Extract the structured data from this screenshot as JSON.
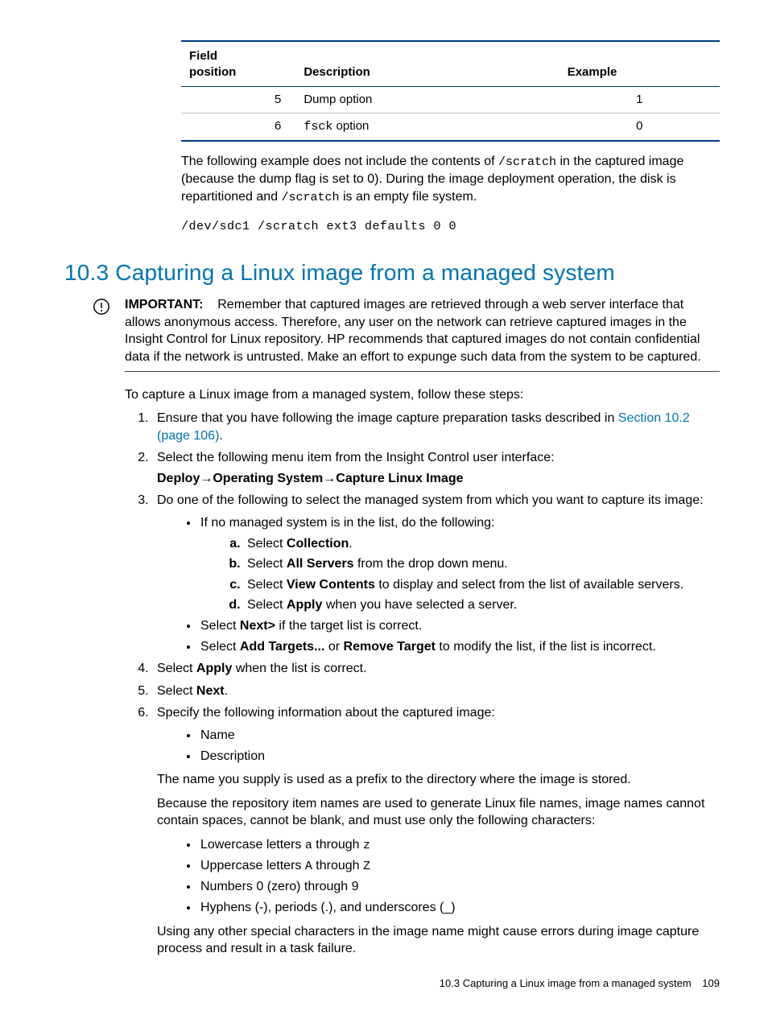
{
  "table": {
    "headers": {
      "c1a": "Field",
      "c1b": "position",
      "c2": "Description",
      "c3": "Example"
    },
    "rows": [
      {
        "pos": "5",
        "desc_pre": "Dump option",
        "desc_mono": "",
        "ex": "1"
      },
      {
        "pos": "6",
        "desc_pre": "",
        "desc_mono": "fsck",
        "desc_post": " option",
        "ex": "0"
      }
    ]
  },
  "para1_a": "The following example does not include the contents of ",
  "para1_mono1": "/scratch",
  "para1_b": " in the captured image (because the dump flag is set to 0). During the image deployment operation, the disk is repartitioned and ",
  "para1_mono2": "/scratch",
  "para1_c": " is an empty file system.",
  "codeline": "/dev/sdc1 /scratch ext3 defaults 0 0",
  "section_title": "10.3 Capturing a Linux image from a managed system",
  "important": {
    "label": "IMPORTANT:",
    "text": "Remember that captured images are retrieved through a web server interface that allows anonymous access. Therefore, any user on the network can retrieve captured images in the Insight Control for Linux repository. HP recommends that captured images do not contain confidential data if the network is untrusted. Make an effort to expunge such data from the system to be captured."
  },
  "intro": "To capture a Linux image from a managed system, follow these steps:",
  "step1_a": "Ensure that you have following the image capture preparation tasks described in ",
  "step1_link": "Section 10.2 (page 106)",
  "step1_b": ".",
  "step2": "Select the following menu item from the Insight Control user interface:",
  "menu_path": "Deploy→Operating System→Capture Linux Image",
  "step3": "Do one of the following to select the managed system from which you want to capture its image:",
  "s3_b1": "If no managed system is in the list, do the following:",
  "s3_b1_a_pre": "Select ",
  "s3_b1_a_bold": "Collection",
  "s3_b1_a_post": ".",
  "s3_b1_b_pre": "Select ",
  "s3_b1_b_bold": "All Servers",
  "s3_b1_b_post": " from the drop down menu.",
  "s3_b1_c_pre": "Select ",
  "s3_b1_c_bold": "View Contents",
  "s3_b1_c_post": " to display and select from the list of available servers.",
  "s3_b1_d_pre": "Select ",
  "s3_b1_d_bold": "Apply",
  "s3_b1_d_post": " when you have selected a server.",
  "s3_b2_pre": "Select ",
  "s3_b2_bold": "Next>",
  "s3_b2_post": " if the target list is correct.",
  "s3_b3_pre": "Select ",
  "s3_b3_bold1": "Add Targets...",
  "s3_b3_mid": " or ",
  "s3_b3_bold2": "Remove Target",
  "s3_b3_post": " to modify the list, if the list is incorrect.",
  "step4_pre": "Select ",
  "step4_bold": "Apply",
  "step4_post": " when the list is correct.",
  "step5_pre": "Select ",
  "step5_bold": "Next",
  "step5_post": ".",
  "step6": "Specify the following information about the captured image:",
  "s6_b1": "Name",
  "s6_b2": "Description",
  "s6_p1": "The name you supply is used as a prefix to the directory where the image is stored.",
  "s6_p2": "Because the repository item names are used to generate Linux file names, image names cannot contain spaces, cannot be blank, and must use only the following characters:",
  "s6_c1_a": "Lowercase letters ",
  "s6_c1_m1": "a",
  "s6_c1_b": " through ",
  "s6_c1_m2": "z",
  "s6_c2_a": "Uppercase letters ",
  "s6_c2_m1": "A",
  "s6_c2_b": " through ",
  "s6_c2_m2": "Z",
  "s6_c3": "Numbers 0 (zero) through 9",
  "s6_c4": "Hyphens (-), periods (.), and underscores (_)",
  "s6_p3": "Using any other special characters in the image name might cause errors during image capture process and result in a task failure.",
  "footer_text": "10.3 Capturing a Linux image from a managed system",
  "footer_page": "109"
}
